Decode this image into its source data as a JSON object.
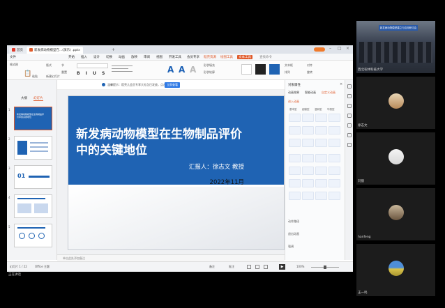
{
  "tabs": [
    {
      "label": "首页",
      "color": "#e0392b"
    },
    {
      "label": "新发病动物模型在...(演示) .pptx",
      "color": "#e05a2a"
    }
  ],
  "menu": [
    "文件",
    "开始",
    "插入",
    "设计",
    "切换",
    "动画",
    "放映",
    "审阅",
    "视图",
    "开发工具",
    "会员专享",
    "稻壳资源",
    "绘图工具",
    "文本工具",
    "查找命令"
  ],
  "ribbon": {
    "left_groups": [
      "格式刷",
      "粘贴",
      "新建幻灯片",
      "版式",
      "节",
      "重置"
    ],
    "font_value": "",
    "text_styles": [
      "A",
      "A",
      "A"
    ],
    "right_groups": [
      "形状填充",
      "形状轮廓",
      "文本框",
      "排列",
      "对齐",
      "旋转"
    ]
  },
  "notice": {
    "text": "温馨提示：稻壳儿会员专享大礼包已发放，点击查看",
    "button": "立即查看"
  },
  "thumbs": {
    "tab_outline": "大纲",
    "tab_slides": "幻灯片",
    "numbers": [
      "1",
      "2",
      "3",
      "4",
      "5"
    ],
    "slide3_num": "01",
    "slide1_caption": "新发病动物模型在生物制品评价中的关键地位"
  },
  "slide": {
    "title_line1": "新发病动物模型在生物制品评价",
    "title_line2": "中的关键地位",
    "reporter": "汇报人：徐志文 教授",
    "date": "2022年11月"
  },
  "notes_placeholder": "单击此处添加备注",
  "pane": {
    "title": "对象属性",
    "tabs": [
      "动画效果",
      "智能动画",
      "自定义动画"
    ],
    "section_label": "进入动画",
    "row_labels": [
      "基本型",
      "细微型",
      "温和型",
      "华丽型"
    ],
    "sections": [
      "动作路径",
      "退出动画",
      "强调"
    ]
  },
  "status": {
    "slide_info": "幻灯片 1 / 22",
    "theme": "Office 主题",
    "notes_btn": "备注",
    "comment_btn": "批注",
    "zoom": "100%"
  },
  "participants": [
    {
      "name": "西北农林科技大学"
    },
    {
      "name": "徐志文"
    },
    {
      "name": "刘丽"
    },
    {
      "name": "hanfeng"
    },
    {
      "name": "王一鸣"
    }
  ],
  "conference_banner": "新发病动物模型建立与应用研讨会",
  "taskbar_text": "正在讲话"
}
